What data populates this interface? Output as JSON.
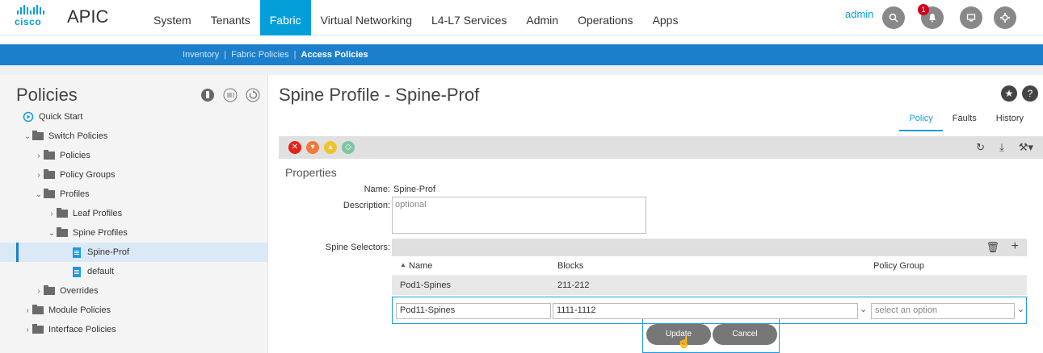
{
  "app": {
    "logo_text": "cisco",
    "title": "APIC",
    "user": "admin",
    "notification_count": "1"
  },
  "nav": {
    "items": [
      "System",
      "Tenants",
      "Fabric",
      "Virtual Networking",
      "L4-L7 Services",
      "Admin",
      "Operations",
      "Apps"
    ],
    "active": "Fabric"
  },
  "subnav": {
    "items": [
      "Inventory",
      "Fabric Policies",
      "Access Policies"
    ],
    "separator": "|",
    "active": "Access Policies"
  },
  "sidebar": {
    "title": "Policies",
    "tree": [
      {
        "label": "Quick Start"
      },
      {
        "label": "Switch Policies"
      },
      {
        "label": "Policies"
      },
      {
        "label": "Policy Groups"
      },
      {
        "label": "Profiles"
      },
      {
        "label": "Leaf Profiles"
      },
      {
        "label": "Spine Profiles"
      },
      {
        "label": "Spine-Prof"
      },
      {
        "label": "default"
      },
      {
        "label": "Overrides"
      },
      {
        "label": "Module Policies"
      },
      {
        "label": "Interface Policies"
      }
    ]
  },
  "main": {
    "title": "Spine Profile - Spine-Prof",
    "tabs": [
      "Policy",
      "Faults",
      "History"
    ],
    "active_tab": "Policy",
    "properties_title": "Properties",
    "name_label": "Name:",
    "name_value": "Spine-Prof",
    "description_label": "Description:",
    "description_placeholder": "optional",
    "spine_selectors_label": "Spine Selectors:",
    "columns": [
      "Name",
      "Blocks",
      "Policy Group"
    ],
    "rows": [
      {
        "name": "Pod1-Spines",
        "blocks": "211-212"
      }
    ],
    "edit_row": {
      "name": "Pod11-Spines",
      "blocks": "1111-1112",
      "policy_group_placeholder": "select an option"
    },
    "buttons": {
      "update": "Update",
      "cancel": "Cancel"
    }
  },
  "icons": {
    "colors": {
      "accent": "#049fd9",
      "subnav": "#1c7fcb",
      "fault_critical": "#e2231a",
      "fault_major": "#f0793a",
      "fault_minor": "#f2c12e",
      "fault_warning": "#7ec5a1"
    }
  }
}
